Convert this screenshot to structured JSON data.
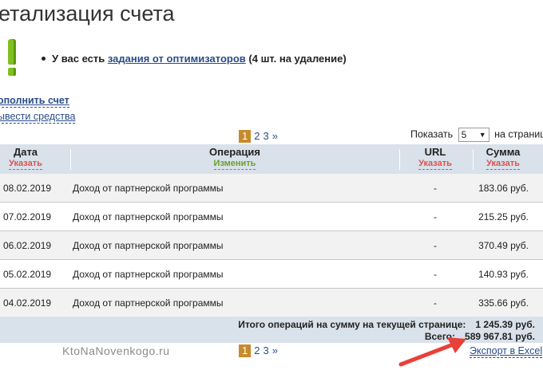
{
  "title": "етализация счета",
  "notice": {
    "prefix": "У вас есть ",
    "link": "задания от оптимизаторов",
    "suffix": " (4 шт. на удаление)"
  },
  "links": {
    "top_up": "ополнить счет",
    "withdraw": "ывести средства"
  },
  "pagination": {
    "current": "1",
    "pages": [
      "2",
      "3"
    ],
    "next": "»"
  },
  "per_page": {
    "label_before": "Показать",
    "value": "5",
    "label_after": "на страницу"
  },
  "table": {
    "columns": [
      {
        "label": "Дата",
        "sub": "Указать"
      },
      {
        "label": "Операция",
        "sub": "Изменить"
      },
      {
        "label": "URL",
        "sub": "Указать"
      },
      {
        "label": "Сумма",
        "sub": "Указать"
      }
    ],
    "rows": [
      {
        "date": "08.02.2019",
        "operation": "Доход от партнерской программы",
        "url": "-",
        "sum": "183.06 руб."
      },
      {
        "date": "07.02.2019",
        "operation": "Доход от партнерской программы",
        "url": "-",
        "sum": "215.25 руб."
      },
      {
        "date": "06.02.2019",
        "operation": "Доход от партнерской программы",
        "url": "-",
        "sum": "370.49 руб."
      },
      {
        "date": "05.02.2019",
        "operation": "Доход от партнерской программы",
        "url": "-",
        "sum": "140.93 руб."
      },
      {
        "date": "04.02.2019",
        "operation": "Доход от партнерской программы",
        "url": "-",
        "sum": "335.66 руб."
      }
    ],
    "footer": {
      "page_total_label": "Итого операций на сумму на текущей странице:",
      "page_total_value": "1 245.39 руб.",
      "grand_total_label": "Всего:",
      "grand_total_value": "589 967.81 руб."
    }
  },
  "watermark": "KtoNaNovenkogo.ru",
  "export_label": "Экспорт в Excel",
  "colors": {
    "accent_link": "#2a4c88",
    "table_header": "#d9e1ea",
    "current_page": "#c98a2b",
    "sort_link_red": "#d9534f",
    "sort_link_green": "#6aa12a",
    "exclamation": "#7fbf1f",
    "arrow": "#e8403a"
  }
}
